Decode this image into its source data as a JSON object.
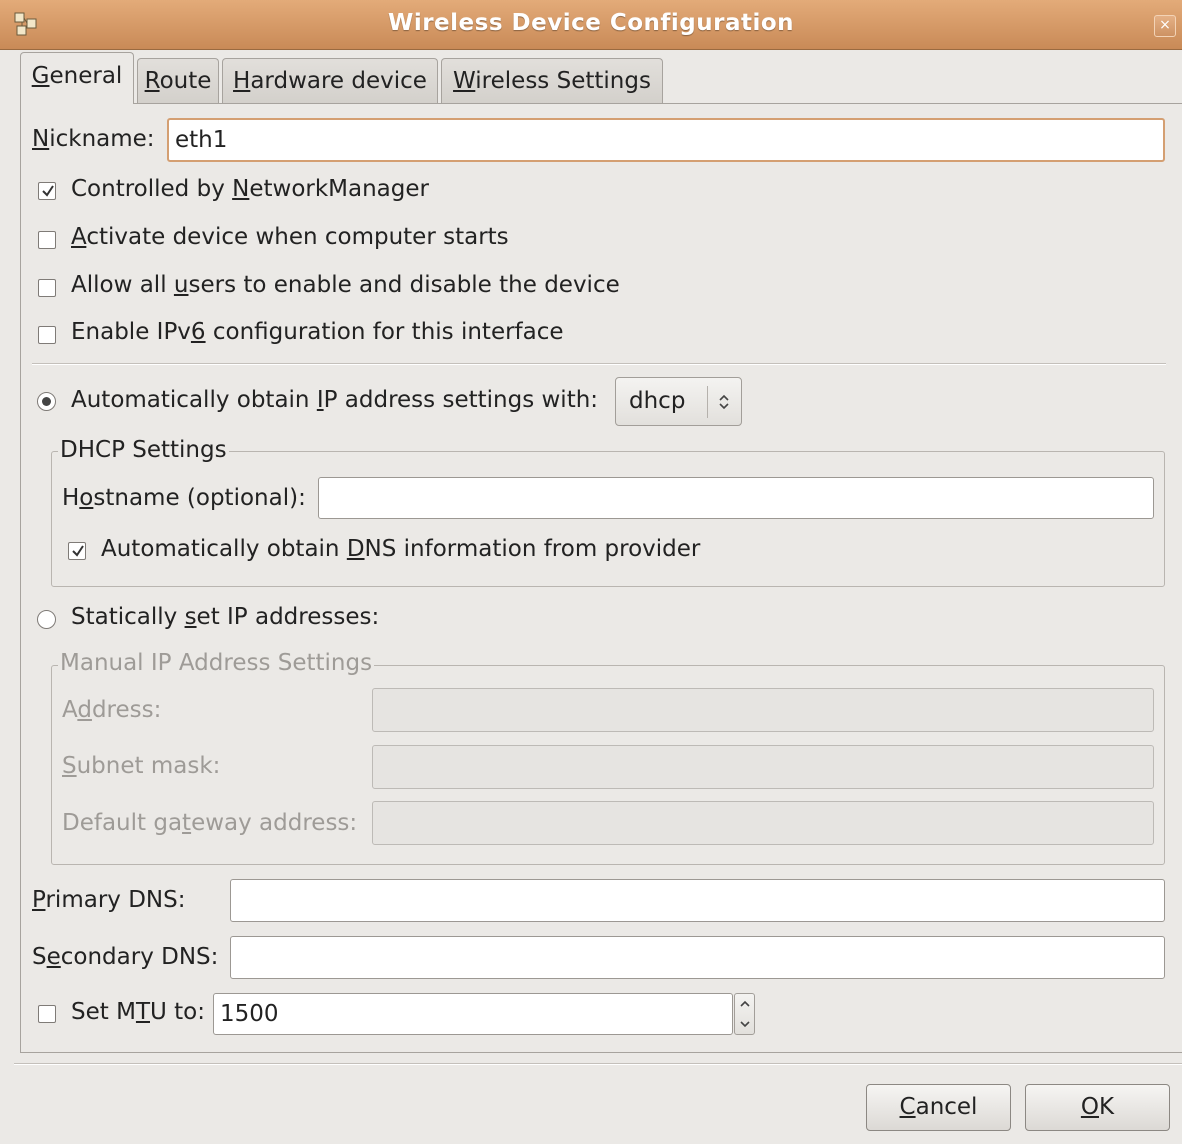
{
  "window": {
    "title": "Wireless Device Configuration",
    "close_glyph": "×"
  },
  "tabs": [
    {
      "pre": "",
      "key": "G",
      "post": "eneral",
      "active": true
    },
    {
      "pre": "",
      "key": "R",
      "post": "oute",
      "active": false
    },
    {
      "pre": "",
      "key": "H",
      "post": "ardware device",
      "active": false
    },
    {
      "pre": "",
      "key": "W",
      "post": "ireless Settings",
      "active": false
    }
  ],
  "general": {
    "nickname": {
      "pre": "",
      "key": "N",
      "post": "ickname:",
      "value": "eth1"
    },
    "checkboxes": [
      {
        "pre": "Controlled by ",
        "key": "N",
        "post": "etworkManager",
        "checked": true
      },
      {
        "pre": "",
        "key": "A",
        "post": "ctivate device when computer starts",
        "checked": false
      },
      {
        "pre": "Allow all ",
        "key": "u",
        "post": "sers to enable and disable the device",
        "checked": false
      },
      {
        "pre": "Enable IPv",
        "key": "6",
        "post": " configuration for this interface",
        "checked": false
      }
    ],
    "auto_ip": {
      "pre": "Automatically obtain ",
      "key": "I",
      "post": "P address settings with:",
      "selected": true,
      "protocol": "dhcp",
      "combo_icon": "updown-chevron-icon"
    },
    "dhcp": {
      "legend": "DHCP Settings",
      "hostname": {
        "pre": "H",
        "key": "o",
        "post": "stname (optional):",
        "value": ""
      },
      "auto_dns": {
        "pre": "Automatically obtain ",
        "key": "D",
        "post": "NS information from provider",
        "checked": true
      }
    },
    "static_ip": {
      "pre": "Statically ",
      "key": "s",
      "post": "et IP addresses:",
      "selected": false
    },
    "manual": {
      "legend": "Manual IP Address Settings",
      "address": {
        "pre": "A",
        "key": "d",
        "post": "dress:",
        "value": ""
      },
      "subnet": {
        "pre": "",
        "key": "S",
        "post": "ubnet mask:",
        "value": ""
      },
      "gateway": {
        "pre": "Default ga",
        "key": "t",
        "post": "eway address:",
        "value": ""
      }
    },
    "primary_dns": {
      "pre": "",
      "key": "P",
      "post": "rimary DNS:",
      "value": ""
    },
    "secondary_dns": {
      "pre": "S",
      "key": "e",
      "post": "condary DNS:",
      "value": ""
    },
    "mtu": {
      "pre": "Set M",
      "key": "T",
      "post": "U to:",
      "value": "1500",
      "checked": false
    }
  },
  "buttons": {
    "cancel": {
      "pre": "",
      "key": "C",
      "post": "ancel"
    },
    "ok": {
      "pre": "",
      "key": "O",
      "post": "K"
    }
  }
}
